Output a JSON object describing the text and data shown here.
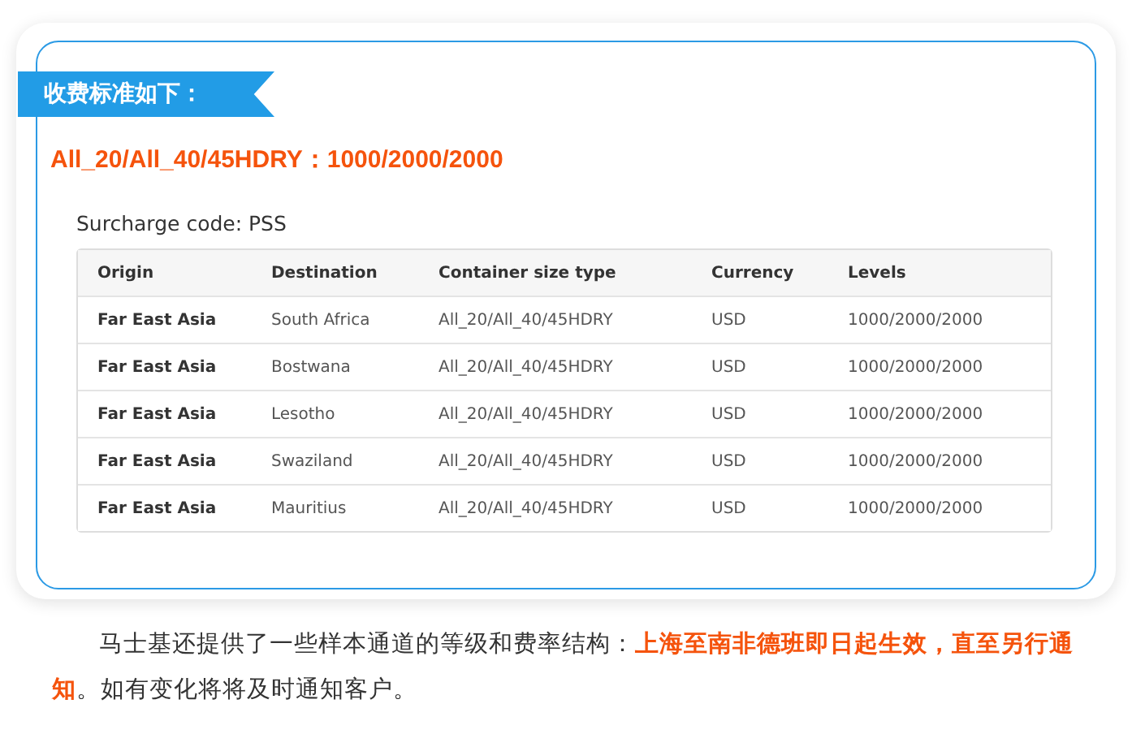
{
  "banner": {
    "title": "收费标准如下："
  },
  "headline": "All_20/All_40/45HDRY：1000/2000/2000",
  "surcharge": "Surcharge code: PSS",
  "table": {
    "columns": [
      "Origin",
      "Destination",
      "Container size type",
      "Currency",
      "Levels"
    ],
    "rows": [
      [
        "Far East Asia",
        "South Africa",
        "All_20/All_40/45HDRY",
        "USD",
        "1000/2000/2000"
      ],
      [
        "Far East Asia",
        "Bostwana",
        "All_20/All_40/45HDRY",
        "USD",
        "1000/2000/2000"
      ],
      [
        "Far East Asia",
        "Lesotho",
        "All_20/All_40/45HDRY",
        "USD",
        "1000/2000/2000"
      ],
      [
        "Far East Asia",
        "Swaziland",
        "All_20/All_40/45HDRY",
        "USD",
        "1000/2000/2000"
      ],
      [
        "Far East Asia",
        "Mauritius",
        "All_20/All_40/45HDRY",
        "USD",
        "1000/2000/2000"
      ]
    ]
  },
  "paragraph": "马士基还提供了一些样本通道的等级和费率结构：**上海至南非德班即日起生效，直至另行通知**。如有变化将将及时通知客户。"
}
